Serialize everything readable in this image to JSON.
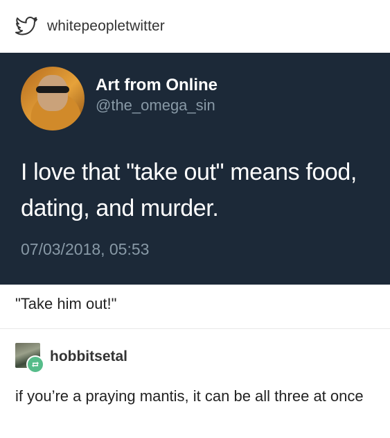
{
  "header": {
    "icon": "tumblr-follow-bird-icon",
    "blog_name": "whitepeopletwitter"
  },
  "tweet": {
    "display_name": "Art from Online",
    "handle": "@the_omega_sin",
    "text": "I love that \"take out\" means food, dating, and murder.",
    "timestamp": "07/03/2018, 05:53",
    "colors": {
      "background": "#1c2938",
      "secondary_text": "#8899a6"
    }
  },
  "reblog": {
    "comment": "\"Take him out!\""
  },
  "reply": {
    "username": "hobbitsetal",
    "badge_icon": "reblog-icon",
    "text": "if you’re a praying mantis, it can be all three at once",
    "badge_color": "#56bc8a"
  }
}
